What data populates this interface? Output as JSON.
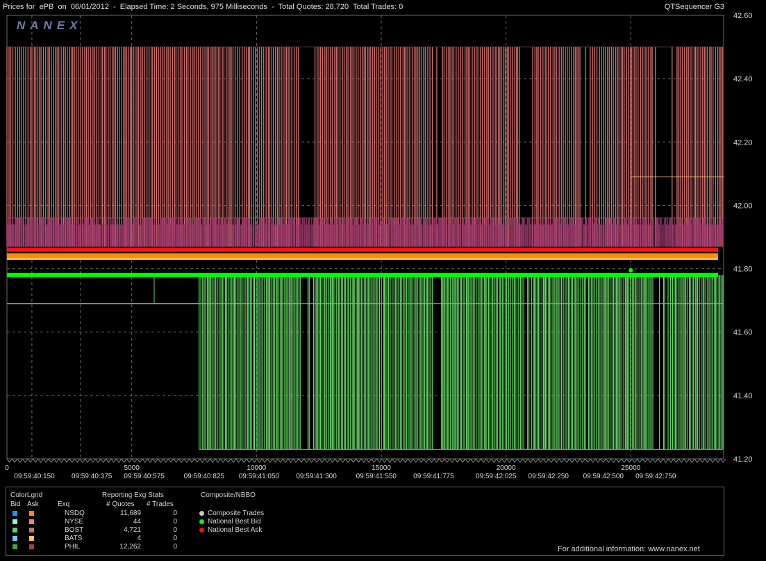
{
  "header": {
    "title": "Prices for  ePB  on  06/01/2012  -  Elapsed Time: 2 Seconds, 975 Milliseconds  -  Total Quotes: 28,720  Total Trades: 0",
    "app_name": "QTSequencer G3",
    "logo": "NANEX"
  },
  "chart_data": {
    "type": "line",
    "ylim": [
      41.2,
      42.6
    ],
    "y_ticks": [
      "42.60",
      "42.40",
      "42.20",
      "42.00",
      "41.80",
      "41.60",
      "41.40",
      "41.20"
    ],
    "x_range": [
      0,
      28720
    ],
    "x_ticks": [
      {
        "x": 0,
        "label": "0"
      },
      {
        "x": 5000,
        "label": "5000"
      },
      {
        "x": 10000,
        "label": "10000"
      },
      {
        "x": 15000,
        "label": "15000"
      },
      {
        "x": 20000,
        "label": "20000"
      },
      {
        "x": 25000,
        "label": "25000"
      }
    ],
    "time_labels": [
      {
        "x": 1100,
        "label": "09:59:40:150"
      },
      {
        "x": 3400,
        "label": "09:59:40:375"
      },
      {
        "x": 5500,
        "label": "09:59:40:575"
      },
      {
        "x": 7900,
        "label": "09:59:40:825"
      },
      {
        "x": 10100,
        "label": "09:59:41:050"
      },
      {
        "x": 12400,
        "label": "09:59:41:300"
      },
      {
        "x": 14800,
        "label": "09:59:41:550"
      },
      {
        "x": 17100,
        "label": "09:59:41:775"
      },
      {
        "x": 19600,
        "label": "09:59:42:025"
      },
      {
        "x": 21700,
        "label": "09:59:42:250"
      },
      {
        "x": 23900,
        "label": "09:59:42:500"
      },
      {
        "x": 26000,
        "label": "09:59:42:750"
      }
    ],
    "v_grid_x": [
      5000,
      10000,
      15000,
      20000,
      25000
    ],
    "v_grid_extra_x": [
      1000,
      2950
    ],
    "series": [
      {
        "name": "BOST",
        "side": "ask",
        "color": "#d07070",
        "base": 41.87,
        "spike": 42.5,
        "x_start": 0,
        "x_end": 28700
      },
      {
        "name": "PHIL",
        "side": "ask",
        "color": "#a03a6e",
        "base": 41.87,
        "spike": 41.96,
        "x_start": 0,
        "x_end": 28700
      },
      {
        "name": "National Best Ask",
        "side": "nbbo",
        "color": "#ff1010",
        "value": 41.86
      },
      {
        "name": "NSDQ",
        "side": "ask",
        "color": "#ff8c00",
        "value": 41.84
      },
      {
        "name": "BATS",
        "side": "ask",
        "color": "#ffc040",
        "value": 41.83
      },
      {
        "name": "National Best Bid",
        "side": "nbbo",
        "color": "#00ff00",
        "value": 41.78
      },
      {
        "name": "BOST",
        "side": "bid",
        "color": "#66d066",
        "base": 41.78,
        "spike": 41.23,
        "x_start": 7700,
        "x_end": 28700,
        "pre_value": 41.69
      }
    ],
    "ref_lines": [
      {
        "value": 42.09,
        "x_start": 25000,
        "color": "#e8c070"
      },
      {
        "value": 41.96,
        "x_start": 0,
        "color": "#a06070"
      },
      {
        "value": 41.69,
        "x_start": 0,
        "color": "#80c080"
      }
    ]
  },
  "legend": {
    "color_lgnd_title": "ColorLgnd",
    "bid_header": "Bid",
    "ask_header": "Ask",
    "exq_header": "Exq",
    "stats_title": "Reporting Exg Stats",
    "quotes_header": "# Quotes",
    "trades_header": "# Trades",
    "rows": [
      {
        "exchange": "NSDQ",
        "quotes": "11,689",
        "trades": "0",
        "bid_color": "#1e90ff",
        "ask_color": "#ff8c00"
      },
      {
        "exchange": "NYSE",
        "quotes": "44",
        "trades": "0",
        "bid_color": "#7fffd4",
        "ask_color": "#f08080"
      },
      {
        "exchange": "BOST",
        "quotes": "4,721",
        "trades": "0",
        "bid_color": "#66d066",
        "ask_color": "#d07070"
      },
      {
        "exchange": "BATS",
        "quotes": "4",
        "trades": "0",
        "bid_color": "#6ec8ff",
        "ask_color": "#ffc060"
      },
      {
        "exchange": "PHIL",
        "quotes": "12,262",
        "trades": "0",
        "bid_color": "#5a9a3a",
        "ask_color": "#a03a6e"
      }
    ],
    "composite_title": "Composite/NBBO",
    "composite_items": [
      {
        "label": "Composite Trades",
        "color": "#c8c8c8"
      },
      {
        "label": "National Best Bid",
        "color": "#00ff00"
      },
      {
        "label": "National Best Ask",
        "color": "#ff1010"
      }
    ],
    "footer": "For additional information: www.nanex.net"
  }
}
